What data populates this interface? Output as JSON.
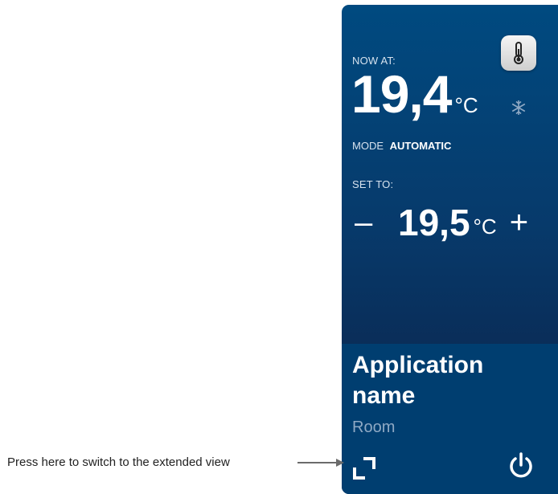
{
  "widget": {
    "now": {
      "label": "NOW AT:",
      "value": "19,4",
      "unit": "°C"
    },
    "mode": {
      "label": "MODE",
      "value": "AUTOMATIC"
    },
    "set": {
      "label": "SET TO:",
      "value": "19,5",
      "unit": "°C",
      "minus": "–",
      "plus": "+"
    },
    "app_name": "Application name",
    "room": "Room"
  },
  "annotation": {
    "text": "Press here to switch to the extended view"
  },
  "icons": [
    "thermometer-icon",
    "snowflake-icon",
    "expand-icon",
    "power-icon",
    "arrow-icon"
  ],
  "colors": {
    "panel_top": "#004a80",
    "panel_bottom": "#0a2a52",
    "footer": "#003e70",
    "muted_text": "#8fa9c4"
  }
}
